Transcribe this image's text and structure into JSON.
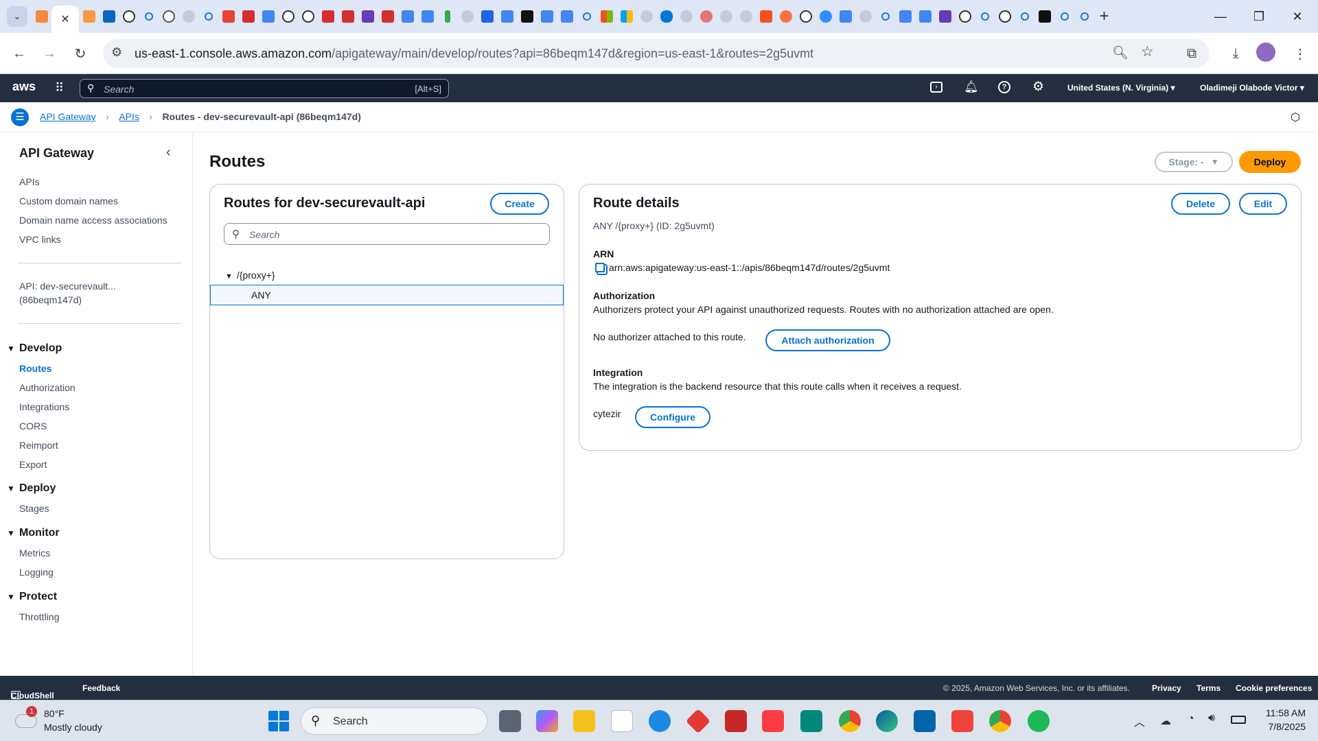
{
  "browser": {
    "url_host": "us-east-1.console.aws.amazon.com",
    "url_path": "/apigateway/main/develop/routes?api=86beqm147d&region=us-east-1&routes=2g5uvmt"
  },
  "aws_nav": {
    "search_placeholder": "Search",
    "search_shortcut": "[Alt+S]",
    "region": "United States (N. Virginia)",
    "user": "Oladimeji Olabode Victor"
  },
  "breadcrumb": {
    "items": [
      "API Gateway",
      "APIs"
    ],
    "current": "Routes - dev-securevault-api (86beqm147d)"
  },
  "sidebar": {
    "title": "API Gateway",
    "top_links": [
      "APIs",
      "Custom domain names",
      "Domain name access associations",
      "VPC links"
    ],
    "api_line1": "API: dev-securevault...",
    "api_line2": "(86beqm147d)",
    "sections": [
      {
        "title": "Develop",
        "items": [
          "Routes",
          "Authorization",
          "Integrations",
          "CORS",
          "Reimport",
          "Export"
        ]
      },
      {
        "title": "Deploy",
        "items": [
          "Stages"
        ]
      },
      {
        "title": "Monitor",
        "items": [
          "Metrics",
          "Logging"
        ]
      },
      {
        "title": "Protect",
        "items": [
          "Throttling"
        ]
      }
    ],
    "active_item": "Routes"
  },
  "page": {
    "title": "Routes",
    "stage_label": "Stage: -",
    "deploy_label": "Deploy"
  },
  "routes_panel": {
    "title": "Routes for dev-securevault-api",
    "create_label": "Create",
    "search_placeholder": "Search",
    "tree_path": "/{proxy+}",
    "tree_method": "ANY"
  },
  "details_panel": {
    "title": "Route details",
    "delete_label": "Delete",
    "edit_label": "Edit",
    "subtitle": "ANY /{proxy+} (ID: 2g5uvmt)",
    "arn_label": "ARN",
    "arn_value": "arn:aws:apigateway:us-east-1::/apis/86beqm147d/routes/2g5uvmt",
    "auth_label": "Authorization",
    "auth_desc": "Authorizers protect your API against unauthorized requests. Routes with no authorization attached are open.",
    "auth_status": "No authorizer attached to this route.",
    "attach_label": "Attach authorization",
    "integration_label": "Integration",
    "integration_desc": "The integration is the backend resource that this route calls when it receives a request.",
    "integration_value": "cytezir",
    "configure_label": "Configure"
  },
  "footer": {
    "cloudshell": "CloudShell",
    "feedback": "Feedback",
    "copyright": "© 2025, Amazon Web Services, Inc. or its affiliates.",
    "privacy": "Privacy",
    "terms": "Terms",
    "cookie": "Cookie preferences"
  },
  "taskbar": {
    "weather_temp": "80°F",
    "weather_desc": "Mostly cloudy",
    "search_label": "Search",
    "time": "11:58 AM",
    "date": "7/8/2025",
    "notification_count": "1"
  },
  "colors": {
    "accent": "#0972d3",
    "deploy": "#ff9900",
    "nav": "#232f3e"
  }
}
